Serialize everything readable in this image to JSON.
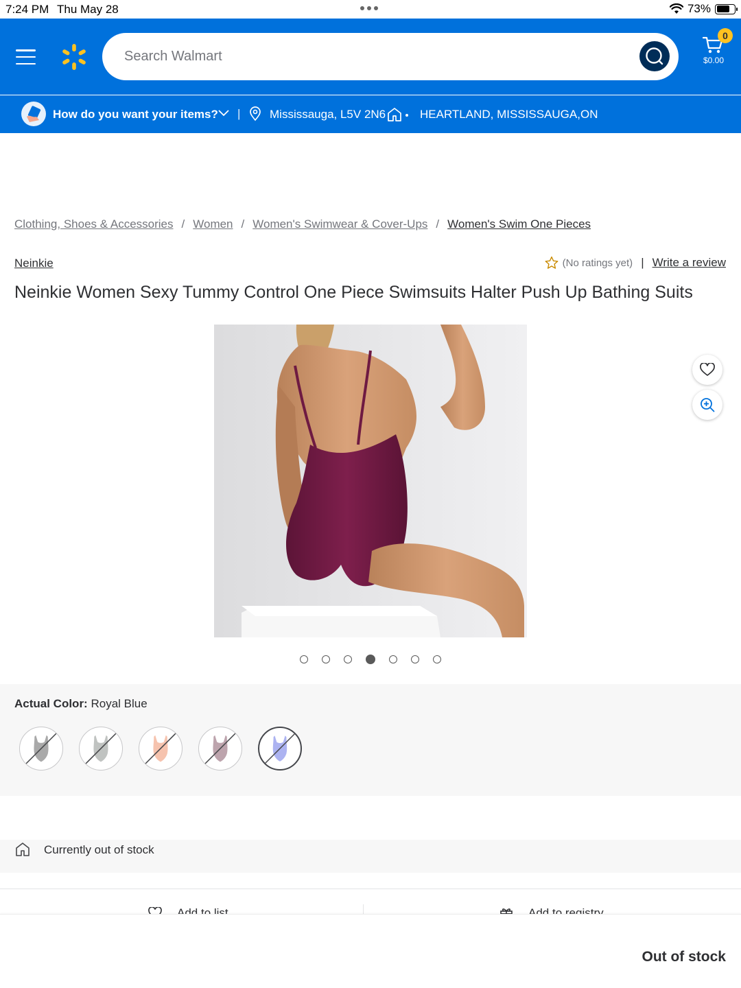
{
  "status_bar": {
    "time": "7:24 PM",
    "date": "Thu May 28",
    "battery": "73%",
    "battery_level": 0.73
  },
  "header": {
    "search_placeholder": "Search Walmart",
    "cart_count": "0",
    "cart_total": "$0.00",
    "brand_color": "#0071dc",
    "spark_color": "#ffc220"
  },
  "fulfillment": {
    "question": "How do you want your items?",
    "separator": "|",
    "location": "Mississauga, L5V 2N6",
    "store": "HEARTLAND, MISSISSAUGA,ON"
  },
  "breadcrumb": [
    "Clothing, Shoes & Accessories",
    "Women",
    "Women's Swimwear & Cover-Ups",
    "Women's Swim One Pieces"
  ],
  "product": {
    "brand": "Neinkie",
    "rating_text": "(No ratings yet)",
    "rating_sep": "|",
    "write_review": "Write a review",
    "title": "Neinkie Women Sexy Tummy Control One Piece Swimsuits Halter Push Up Bathing Suits",
    "image_count": 7,
    "image_active_index": 3
  },
  "color": {
    "label": "Actual Color:",
    "value": "Royal Blue",
    "swatches": [
      {
        "name": "gray",
        "color": "#9a9a9a",
        "unavailable": true
      },
      {
        "name": "light-gray",
        "color": "#b5b8b6",
        "unavailable": true
      },
      {
        "name": "peach",
        "color": "#f4b9a0",
        "unavailable": true
      },
      {
        "name": "mauve",
        "color": "#b2949f",
        "unavailable": true
      },
      {
        "name": "royal-blue",
        "color": "#9ea6ef",
        "unavailable": true,
        "selected": true
      }
    ]
  },
  "availability": {
    "text": "Currently out of stock"
  },
  "actions": {
    "add_to_list": "Add to list",
    "add_to_registry": "Add to registry"
  },
  "bottom": {
    "status": "Out of stock"
  }
}
